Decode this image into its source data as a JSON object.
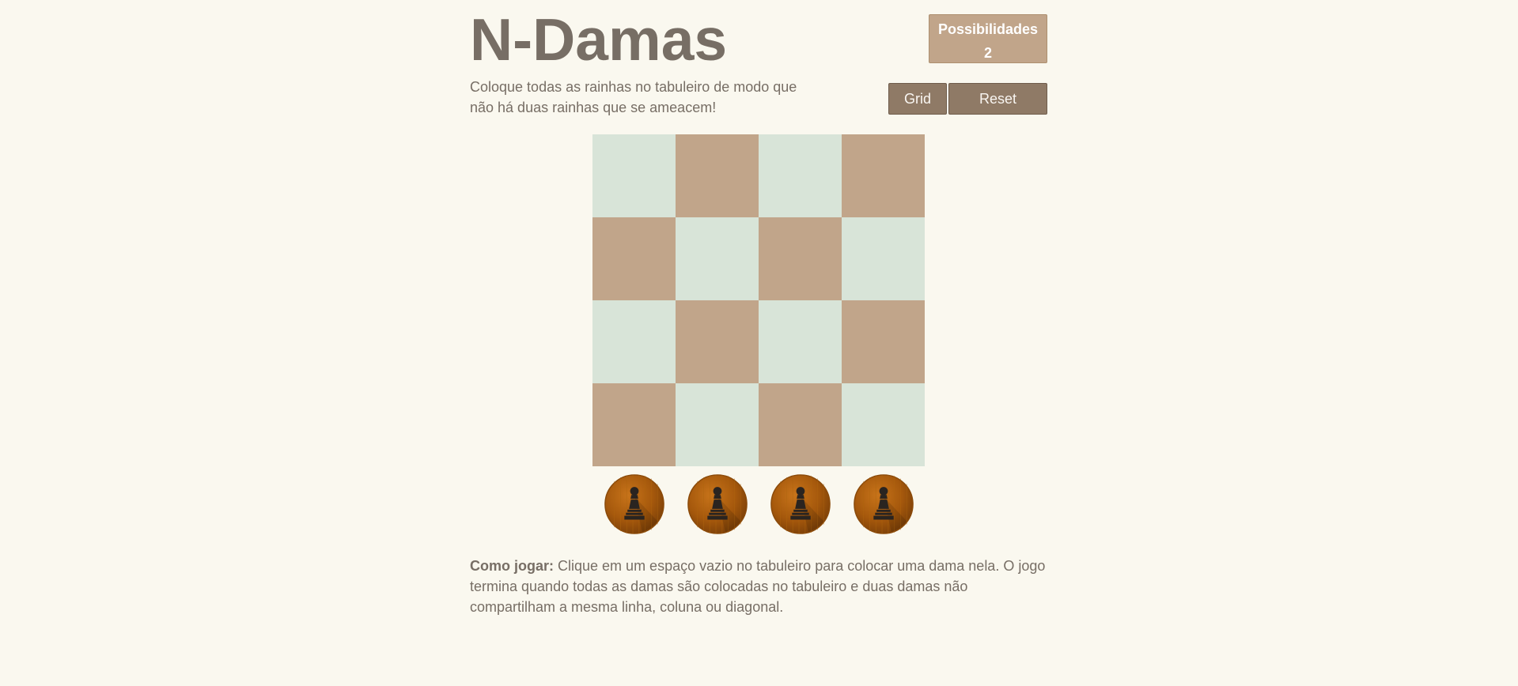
{
  "header": {
    "title": "N-Damas",
    "intro": "Coloque todas as rainhas no tabuleiro de modo que não há duas rainhas que se ameacem!"
  },
  "score": {
    "label": "Possibilidades",
    "value": "2"
  },
  "buttons": {
    "grid_label": "Grid",
    "reset_label": "Reset"
  },
  "board": {
    "size": 4,
    "light_color": "#d8e4d8",
    "dark_color": "#c1a58a",
    "pattern": [
      [
        "light",
        "dark",
        "light",
        "dark"
      ],
      [
        "dark",
        "light",
        "dark",
        "light"
      ],
      [
        "light",
        "dark",
        "light",
        "dark"
      ],
      [
        "dark",
        "light",
        "dark",
        "light"
      ]
    ]
  },
  "tray": {
    "pieces": [
      {
        "icon": "chess-piece-icon"
      },
      {
        "icon": "chess-piece-icon"
      },
      {
        "icon": "chess-piece-icon"
      },
      {
        "icon": "chess-piece-icon"
      }
    ]
  },
  "instructions": {
    "label": "Como jogar:",
    "text": "Clique em um espaço vazio no tabuleiro para colocar uma dama nela. O jogo termina quando todas as damas são colocadas no tabuleiro e duas damas não compartilham a mesma linha, coluna ou diagonal."
  }
}
